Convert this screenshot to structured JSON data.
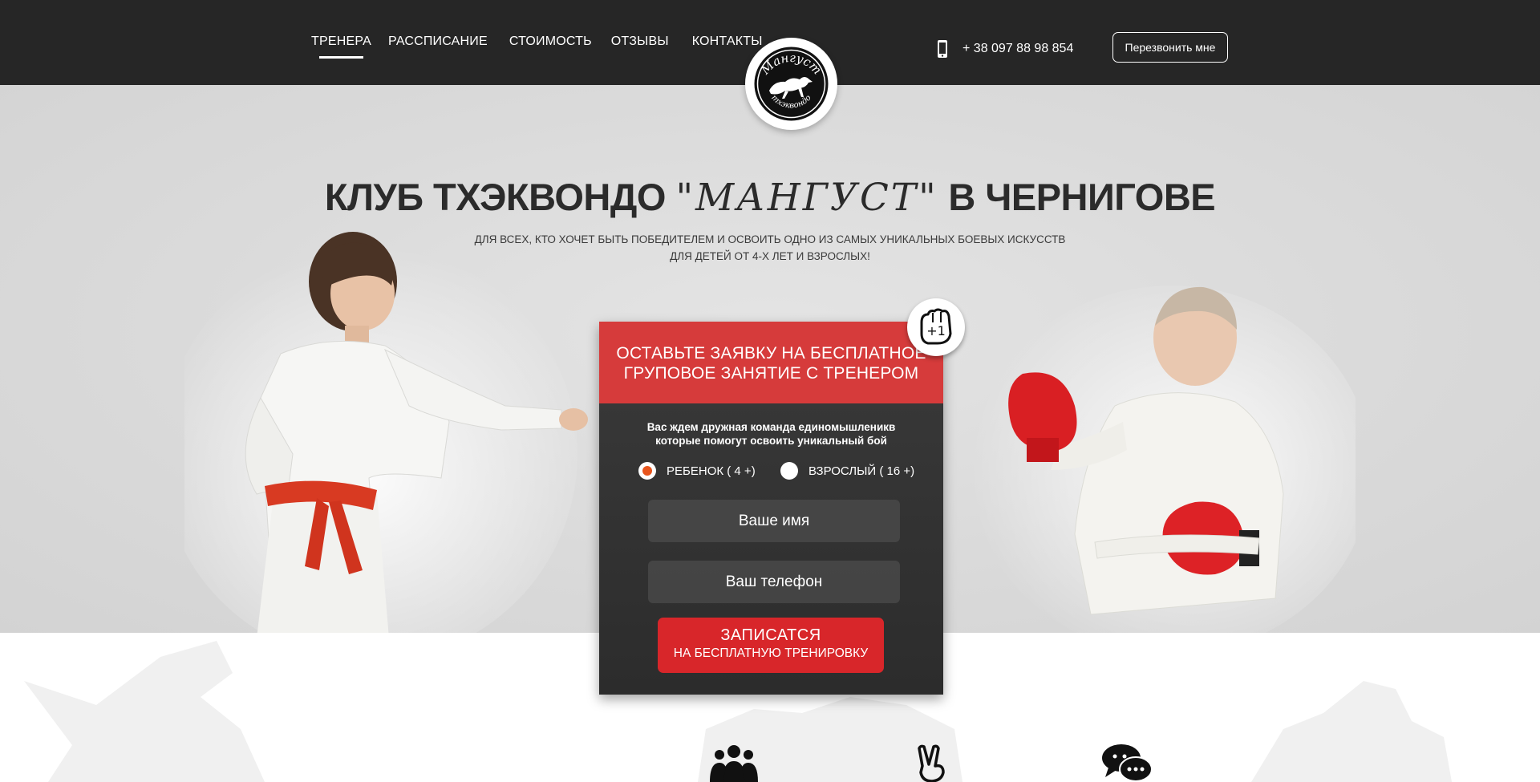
{
  "nav": {
    "items": [
      {
        "label": "ТРЕНЕРА",
        "active": true
      },
      {
        "label": "РАССПИСАНИЕ",
        "active": false
      },
      {
        "label": "СТОИМОСТЬ",
        "active": false
      },
      {
        "label": "ОТЗЫВЫ",
        "active": false
      },
      {
        "label": "КОНТАКТЫ",
        "active": false
      }
    ]
  },
  "logo": {
    "text_top": "Мангуст",
    "text_bottom": "тхэквондо"
  },
  "contact": {
    "phone": "+ 38 097 88 98 854",
    "callback_label": "Перезвонить мне"
  },
  "hero": {
    "title_before": "КЛУБ ТХЭКВОНДО ",
    "title_brand": "\"МАНГУСТ\"",
    "title_after": " В ЧЕРНИГОВЕ",
    "subtitle_line1": "ДЛЯ ВСЕХ, КТО ХОЧЕТ БЫТЬ ПОБЕДИТЕЛЕМ И ОСВОИТЬ ОДНО ИЗ САМЫХ УНИКАЛЬНЫХ БОЕВЫХ ИСКУССТВ",
    "subtitle_line2": "ДЛЯ ДЕТЕЙ ОТ 4-Х ЛЕТ И ВЗРОСЛЫХ!"
  },
  "form": {
    "badge_text": "+1",
    "heading_line1": "ОСТАВЬТЕ ЗАЯВКУ НА БЕСПЛАТНОЕ",
    "heading_line2": "ГРУПОВОЕ ЗАНЯТИЕ С ТРЕНЕРОМ",
    "desc_line1": "Вас ждем дружная команда единомышленикв",
    "desc_line2": "которые помогут освоить уникальный бой",
    "radio_child": "РЕБЕНОК ( 4 +)",
    "radio_adult": "ВЗРОСЛЫЙ ( 16 +)",
    "selected": "child",
    "name_placeholder": "Ваше имя",
    "phone_placeholder": "Ваш телефон",
    "submit_main": "ЗАПИСАТСЯ",
    "submit_sub": "НА БЕСПЛАТНУЮ ТРЕНИРОВКУ"
  },
  "features": {
    "icons": [
      "team-icon",
      "victory-hand-icon",
      "chat-bubbles-icon"
    ]
  },
  "colors": {
    "header_bg": "#262626",
    "accent_red": "#d8262a",
    "form_head_red": "#d63b3b",
    "radio_orange": "#e8551d",
    "hero_bg": "#dadada"
  }
}
